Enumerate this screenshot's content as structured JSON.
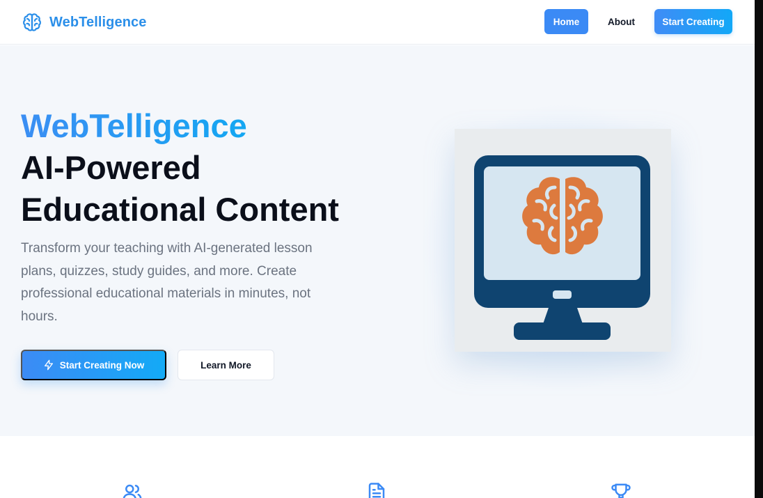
{
  "nav": {
    "brand_name": "WebTelligence",
    "brand_icon": "brain-icon",
    "items": [
      {
        "label": "Home",
        "active": true
      },
      {
        "label": "About",
        "active": false
      }
    ],
    "cta_label": "Start Creating"
  },
  "hero": {
    "title_line1": "WebTelligence",
    "title_line2": "AI-Powered",
    "title_line3": "Educational Content",
    "description": "Transform your teaching with AI-generated lesson plans, quizzes, study guides, and more. Create professional educational materials in minutes, not hours.",
    "primary_button": {
      "label": "Start Creating Now",
      "icon": "lightning-bolt-icon"
    },
    "secondary_button": {
      "label": "Learn More"
    },
    "image": {
      "subject": "computer-monitor-with-brain-icon"
    }
  },
  "features": {
    "icons": [
      "users-icon",
      "document-icon",
      "trophy-icon"
    ]
  },
  "colors": {
    "accent_blue": "#3b8af5",
    "gradient_start": "#3f8cf6",
    "gradient_end": "#12a8f7",
    "monitor_navy": "#0f4470",
    "brain_orange": "#dd7a3e",
    "text_muted": "#6b7380"
  }
}
